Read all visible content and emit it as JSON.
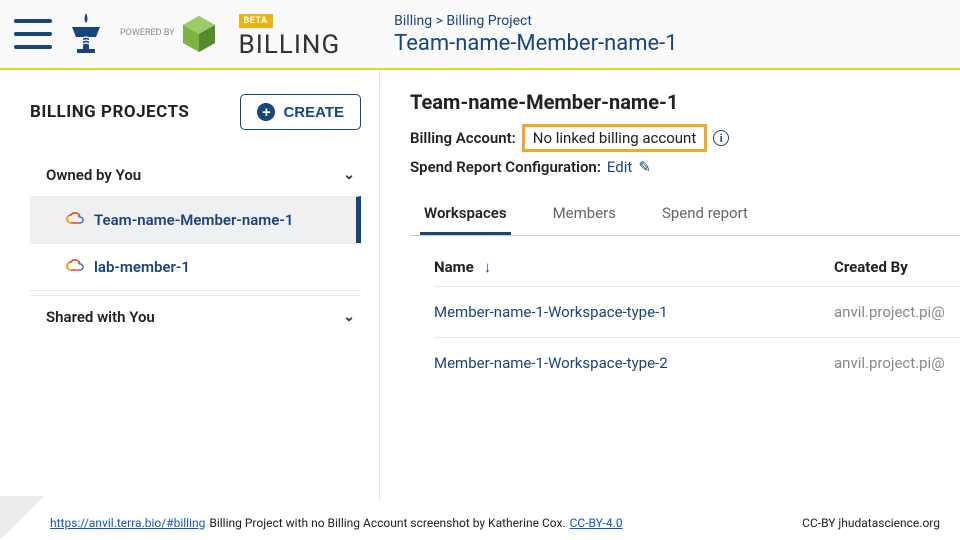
{
  "header": {
    "powered_label": "POWERED BY",
    "beta_badge": "BETA",
    "page_title": "BILLING",
    "breadcrumb_root": "Billing",
    "breadcrumb_sep": ">",
    "breadcrumb_current": "Billing Project",
    "breadcrumb_title": "Team-name-Member-name-1"
  },
  "sidebar": {
    "heading": "BILLING PROJECTS",
    "create_label": "CREATE",
    "sections": {
      "owned": "Owned by You",
      "shared": "Shared with You"
    },
    "projects": [
      {
        "name": "Team-name-Member-name-1"
      },
      {
        "name": "lab-member-1"
      }
    ]
  },
  "main": {
    "project_title": "Team-name-Member-name-1",
    "billing_account_label": "Billing Account:",
    "billing_account_value": "No linked billing account",
    "spend_config_label": "Spend Report Configuration:",
    "spend_config_action": "Edit",
    "tabs": {
      "workspaces": "Workspaces",
      "members": "Members",
      "spend": "Spend report"
    },
    "table": {
      "col_name": "Name",
      "col_created": "Created By",
      "rows": [
        {
          "name": "Member-name-1-Workspace-type-1",
          "created_by": "anvil.project.pi@"
        },
        {
          "name": "Member-name-1-Workspace-type-2",
          "created_by": "anvil.project.pi@"
        }
      ]
    }
  },
  "footer": {
    "url": "https://anvil.terra.bio/#billing",
    "caption": "Billing Project with no Billing Account  screenshot by Katherine Cox.",
    "license_link": "CC-BY-4.0",
    "right": "CC-BY  jhudatascience.org"
  }
}
